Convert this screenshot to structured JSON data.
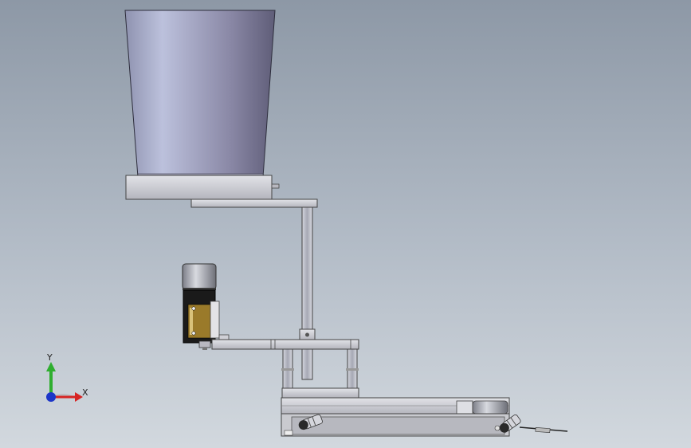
{
  "triad": {
    "y_label": "Y",
    "x_label": "X",
    "colors": {
      "y": "#2fae2f",
      "x": "#d62424",
      "z": "#1c35c8"
    }
  },
  "colors": {
    "background_top": "#8d98a6",
    "background_bottom": "#d2d8de",
    "hopper_light": "#b9bed8",
    "hopper_dark": "#6e6c88",
    "plate": "#c9c9cc",
    "motor_label": "#9a7a2a",
    "motor_body": "#1a1a1a"
  }
}
